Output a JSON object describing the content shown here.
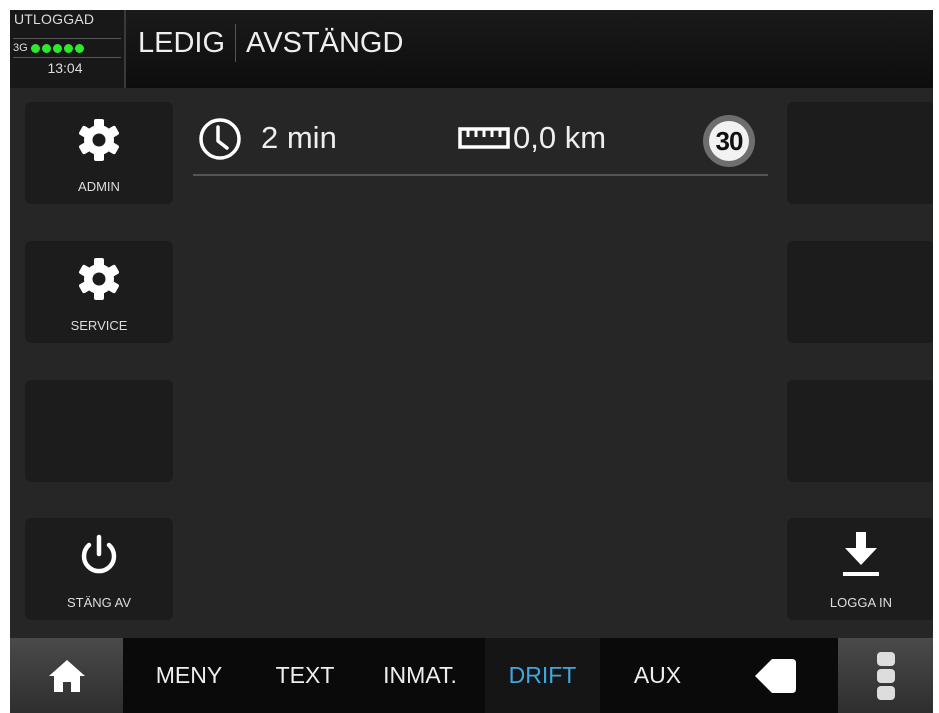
{
  "header": {
    "login_state": "UTLOGGAD",
    "network_label": "3G",
    "signal_bars": 5,
    "clock": "13:04",
    "status_primary": "LEDIG",
    "status_secondary": "AVSTÄNGD"
  },
  "left_buttons": [
    {
      "label": "ADMIN",
      "icon": "gear-icon"
    },
    {
      "label": "SERVICE",
      "icon": "gear-icon"
    },
    {
      "label": "",
      "icon": ""
    },
    {
      "label": "STÄNG AV",
      "icon": "power-icon"
    }
  ],
  "right_buttons": [
    {
      "label": "",
      "icon": ""
    },
    {
      "label": "",
      "icon": ""
    },
    {
      "label": "",
      "icon": ""
    },
    {
      "label": "LOGGA IN",
      "icon": "download-icon"
    }
  ],
  "info": {
    "time": "2 min",
    "distance": "0,0 km",
    "speed_limit": "30"
  },
  "nav": {
    "home_icon": "home-icon",
    "tabs": [
      "MENY",
      "TEXT",
      "INMAT.",
      "DRIFT",
      "AUX"
    ],
    "active_tab": "DRIFT",
    "back_icon": "back-arrow-icon",
    "more_icon": "more-vertical-icon"
  },
  "colors": {
    "background": "#262626",
    "button": "#1c1c1c",
    "signal": "#2ee82e",
    "active_tab": "#3fa7e0"
  }
}
